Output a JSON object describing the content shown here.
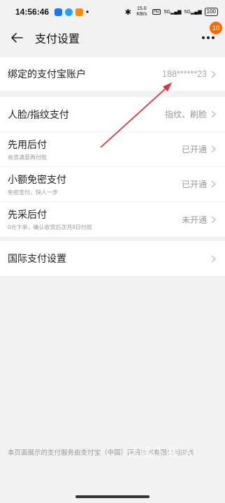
{
  "status_bar": {
    "time": "14:56:46",
    "network_speed": "15.0 KB/s",
    "signal_1": "5G",
    "signal_2": "5G",
    "battery": "100",
    "app_icon_colors": [
      "#1677ff",
      "#1aa6ff",
      "#ff8a00"
    ]
  },
  "nav": {
    "title": "支付设置",
    "badge_count": "10"
  },
  "accent_color": "#ff6a00",
  "arrow_color": "#d9363e",
  "account": {
    "label": "绑定的支付宝账户",
    "value": "188******23"
  },
  "payment_items": [
    {
      "title": "人脸/指纹支付",
      "subtitle": "",
      "value": "指纹、刷脸"
    },
    {
      "title": "先用后付",
      "subtitle": "收货满意再付款",
      "value": "已开通"
    },
    {
      "title": "小额免密支付",
      "subtitle": "免密支付，快人一步",
      "value": "已开通"
    },
    {
      "title": "先采后付",
      "subtitle": "0元下单，确认收货后次月8日付款",
      "value": "未开通"
    }
  ],
  "international": {
    "label": "国际支付设置"
  },
  "footer": {
    "text": "本页面展示的支付服务由支付宝（中国）网络技术有限公司提供",
    "watermark": "话魔下载站"
  }
}
